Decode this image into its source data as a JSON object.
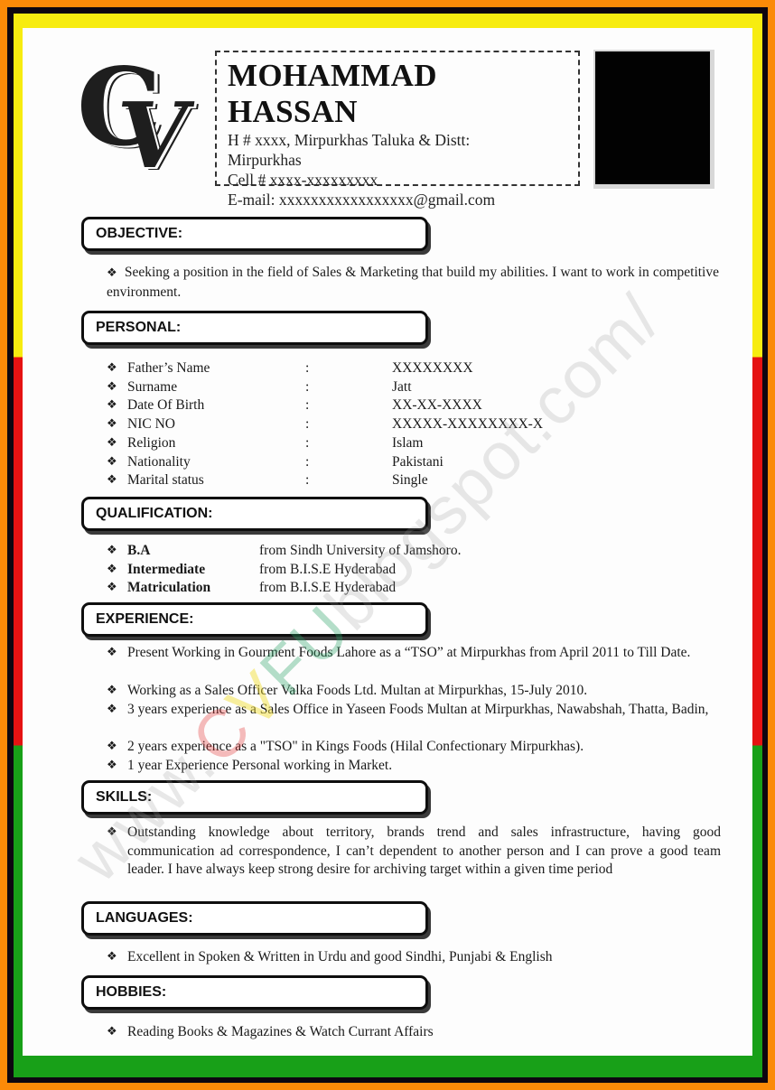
{
  "colors": {
    "outer_border": "#fb8a08",
    "inner_border": "#0d0610",
    "band_top": "#f7ec10",
    "band_middle": "#e51212",
    "band_bottom": "#18a018"
  },
  "logo": {
    "letter1": "C",
    "letter2": "V",
    "icon": "cv-monogram-icon"
  },
  "header": {
    "name": "MOHAMMAD HASSAN",
    "address_line1": "H # xxxx, Mirpurkhas Taluka & Distt:",
    "address_line2": "Mirpurkhas",
    "cell": "Cell # xxxx-xxxxxxxxx",
    "email": "E-mail: xxxxxxxxxxxxxxxxx@gmail.com"
  },
  "bullet_glyph": "❖",
  "sections": {
    "objective": {
      "title": "OBJECTIVE:",
      "text": "Seeking a position in the field of Sales & Marketing that build my abilities. I want to work in competitive environment."
    },
    "personal": {
      "title": "PERSONAL:",
      "separator": ":",
      "rows": [
        {
          "label": "Father’s Name",
          "value": "XXXXXXXX"
        },
        {
          "label": "Surname",
          "value": "Jatt"
        },
        {
          "label": "Date Of Birth",
          "value": "XX-XX-XXXX"
        },
        {
          "label": "NIC NO",
          "value": "XXXXX-XXXXXXXX-X"
        },
        {
          "label": "Religion",
          "value": "Islam"
        },
        {
          "label": "Nationality",
          "value": "Pakistani"
        },
        {
          "label": "Marital status",
          "value": "Single"
        }
      ]
    },
    "qualification": {
      "title": "QUALIFICATION:",
      "rows": [
        {
          "degree": "B.A",
          "from": "from Sindh University of Jamshoro."
        },
        {
          "degree": "Intermediate",
          "from": "from B.I.S.E Hyderabad"
        },
        {
          "degree": "Matriculation",
          "from": "from B.I.S.E Hyderabad"
        }
      ]
    },
    "experience": {
      "title": "EXPERIENCE:",
      "items": [
        "Present Working in Gourment Foods Lahore as a “TSO” at Mirpurkhas from April 2011 to Till Date.",
        "Working as a Sales Officer Valka Foods Ltd. Multan at Mirpurkhas, 15-July 2010.",
        " 3 years experience as a Sales Office in Yaseen Foods Multan at Mirpurkhas, Nawabshah, Thatta, Badin,",
        "2 years experience as a \"TSO\" in Kings Foods (Hilal Confectionary Mirpurkhas).",
        "1 year Experience Personal working in Market."
      ]
    },
    "skills": {
      "title": "SKILLS:",
      "text": "Outstanding knowledge about territory, brands trend and sales infrastructure, having good communication ad correspondence, I can’t dependent to another person and I can prove a good team leader. I have always keep strong desire for archiving target within a given time period"
    },
    "languages": {
      "title": "LANGUAGES:",
      "text": "Excellent in Spoken & Written in Urdu and good Sindhi, Punjabi & English"
    },
    "hobbies": {
      "title": "HOBBIES:",
      "text": "Reading Books & Magazines & Watch Currant Affairs"
    }
  },
  "watermark": {
    "prefix": "www.",
    "part1": "C",
    "part2": "V",
    "part3": "FU",
    "suffix": "blogspot.com/"
  }
}
